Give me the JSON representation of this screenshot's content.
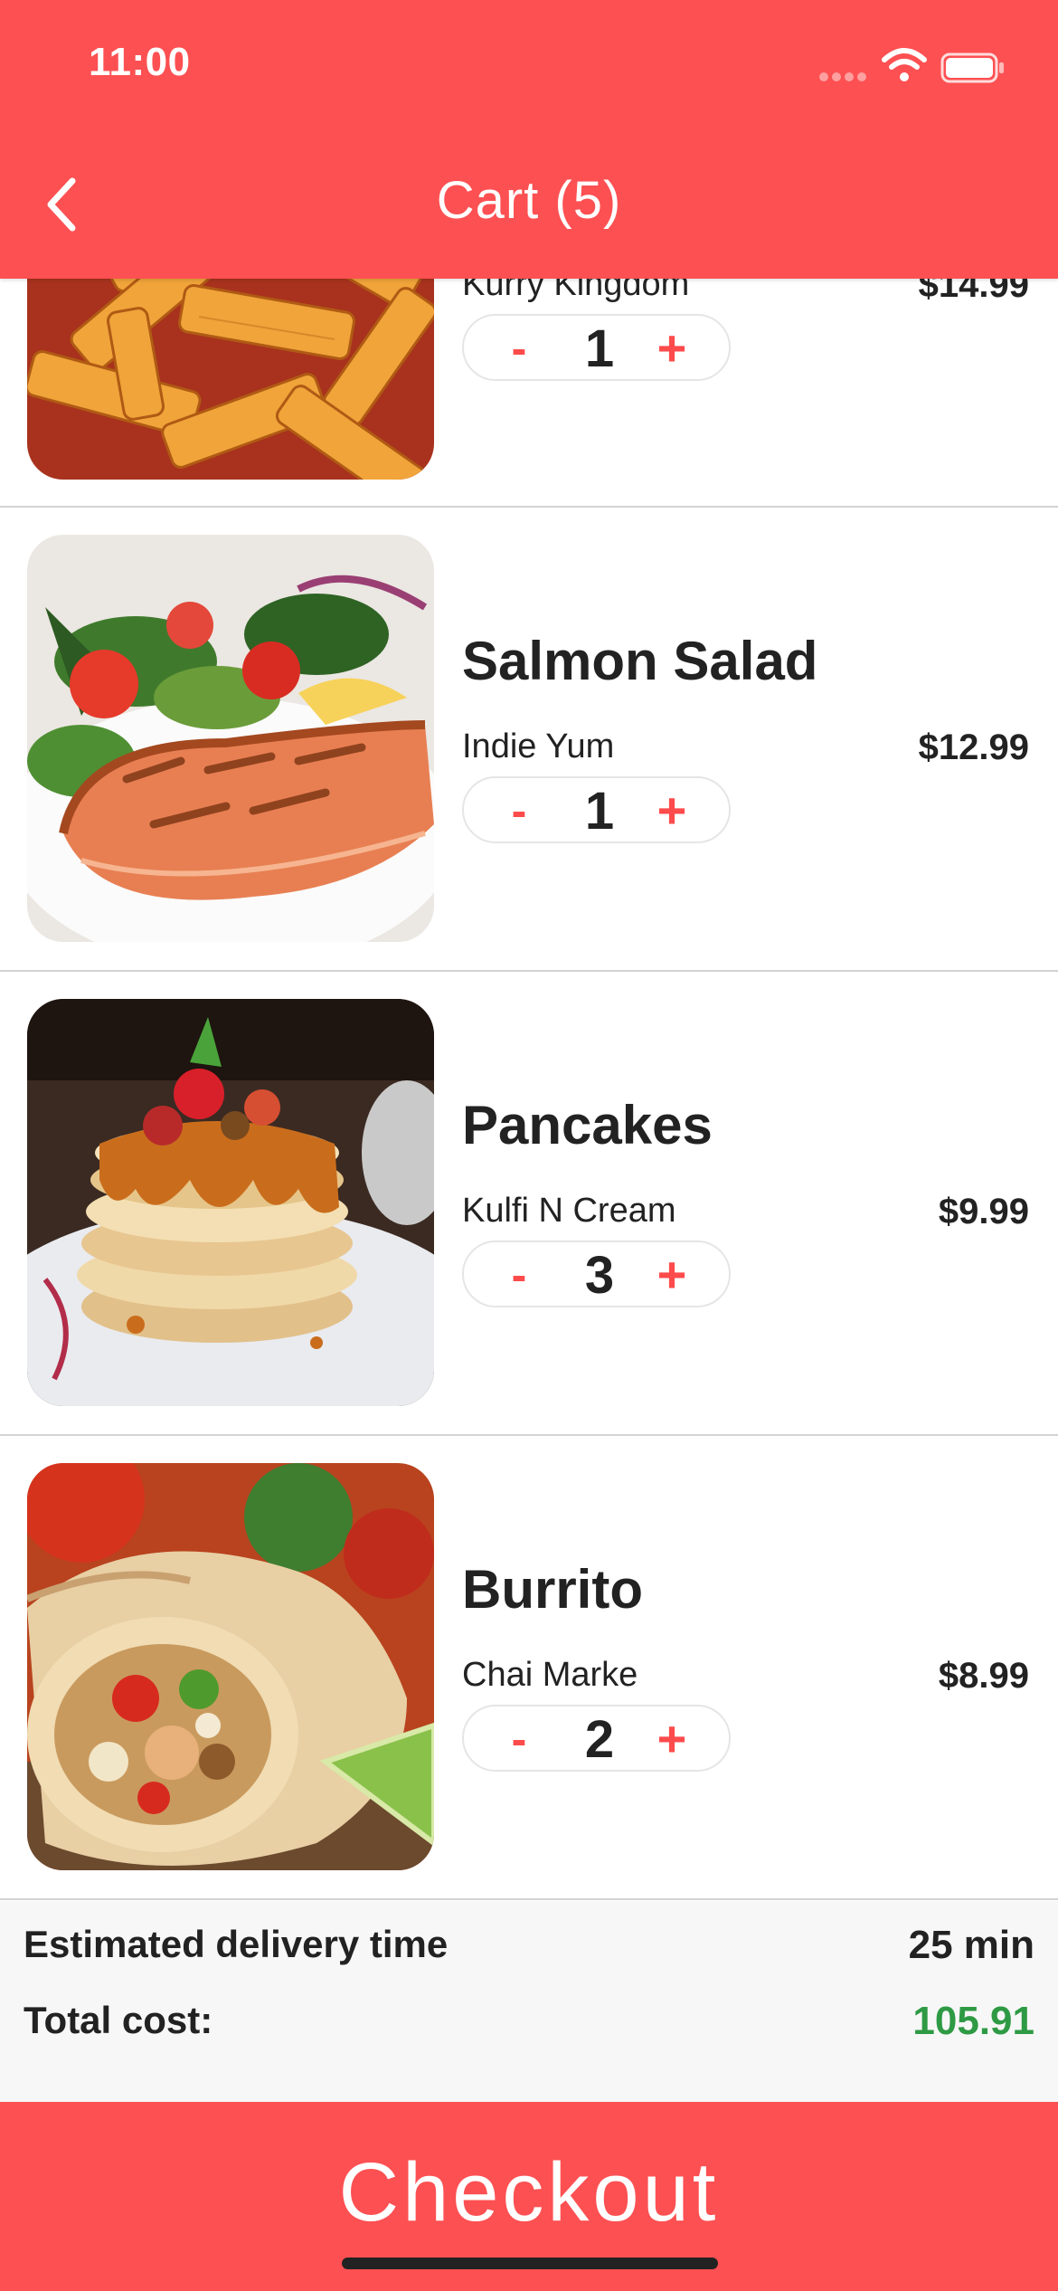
{
  "status_bar": {
    "time": "11:00"
  },
  "header": {
    "title": "Cart (5)"
  },
  "items": [
    {
      "name": "",
      "restaurant": "Kurry Kingdom",
      "price": "$14.99",
      "quantity": "1",
      "minus": "-",
      "plus": "+",
      "image": "penne-pasta-image"
    },
    {
      "name": "Salmon Salad",
      "restaurant": "Indie Yum",
      "price": "$12.99",
      "quantity": "1",
      "minus": "-",
      "plus": "+",
      "image": "salmon-salad-image"
    },
    {
      "name": "Pancakes",
      "restaurant": "Kulfi N Cream",
      "price": "$9.99",
      "quantity": "3",
      "minus": "-",
      "plus": "+",
      "image": "pancakes-image"
    },
    {
      "name": "Burrito",
      "restaurant": "Chai Marke",
      "price": "$8.99",
      "quantity": "2",
      "minus": "-",
      "plus": "+",
      "image": "burrito-image"
    }
  ],
  "summary": {
    "delivery_label": "Estimated delivery time",
    "delivery_value": "25 min",
    "total_label": "Total cost:",
    "total_value": "105.91"
  },
  "checkout": {
    "label": "Checkout"
  },
  "colors": {
    "accent": "#fd5052",
    "total_green": "#2e9a44",
    "stepper_red": "#fd4b4b"
  }
}
